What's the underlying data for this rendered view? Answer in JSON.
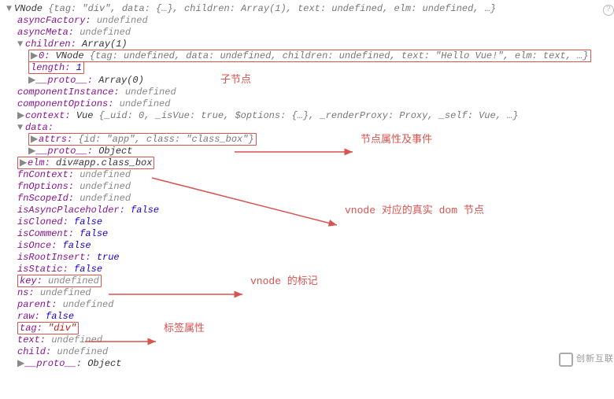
{
  "root": {
    "prefix": "VNode ",
    "summary": "{tag: \"div\", data: {…}, children: Array(1), text: undefined, elm: undefined, …}"
  },
  "lines": {
    "asyncFactory": {
      "k": "asyncFactory: ",
      "v": "undefined"
    },
    "asyncMeta": {
      "k": "asyncMeta: ",
      "v": "undefined"
    },
    "children": {
      "k": "children: ",
      "v": "Array(1)"
    },
    "child0": {
      "k": "0: ",
      "pre": "VNode ",
      "v": "{tag: undefined, data: undefined, children: undefined, text: \"Hello Vue!\", elm: text, …}"
    },
    "childLen": {
      "k": "length: ",
      "v": "1"
    },
    "childProto": {
      "k": "__proto__: ",
      "v": "Array(0)"
    },
    "componentInstance": {
      "k": "componentInstance: ",
      "v": "undefined"
    },
    "componentOptions": {
      "k": "componentOptions: ",
      "v": "undefined"
    },
    "context": {
      "k": "context: ",
      "pre": "Vue ",
      "v": "{_uid: 0, _isVue: true, $options: {…}, _renderProxy: Proxy, _self: Vue, …}"
    },
    "data": {
      "k": "data:"
    },
    "attrs": {
      "k": "attrs: ",
      "v": "{id: \"app\", class: \"class_box\"}"
    },
    "dataProto": {
      "k": "__proto__: ",
      "v": "Object"
    },
    "elm": {
      "k": "elm: ",
      "v": "div#app.class_box"
    },
    "fnContext": {
      "k": "fnContext: ",
      "v": "undefined"
    },
    "fnOptions": {
      "k": "fnOptions: ",
      "v": "undefined"
    },
    "fnScopeId": {
      "k": "fnScopeId: ",
      "v": "undefined"
    },
    "isAsyncPlaceholder": {
      "k": "isAsyncPlaceholder: ",
      "v": "false"
    },
    "isCloned": {
      "k": "isCloned: ",
      "v": "false"
    },
    "isComment": {
      "k": "isComment: ",
      "v": "false"
    },
    "isOnce": {
      "k": "isOnce: ",
      "v": "false"
    },
    "isRootInsert": {
      "k": "isRootInsert: ",
      "v": "true"
    },
    "isStatic": {
      "k": "isStatic: ",
      "v": "false"
    },
    "keyProp": {
      "k": "key: ",
      "v": "undefined"
    },
    "ns": {
      "k": "ns: ",
      "v": "undefined"
    },
    "parent": {
      "k": "parent: ",
      "v": "undefined"
    },
    "raw": {
      "k": "raw: ",
      "v": "false"
    },
    "tag": {
      "k": "tag: ",
      "v": "\"div\""
    },
    "text": {
      "k": "text: ",
      "v": "undefined"
    },
    "child": {
      "k": "child: ",
      "v": "undefined"
    },
    "proto": {
      "k": "__proto__: ",
      "v": "Object"
    }
  },
  "annotations": {
    "children": "子节点",
    "attrs": "节点属性及事件",
    "elm": "vnode 对应的真实 dom 节点",
    "key": "vnode 的标记",
    "tag": "标签属性"
  },
  "watermark": "创新互联"
}
